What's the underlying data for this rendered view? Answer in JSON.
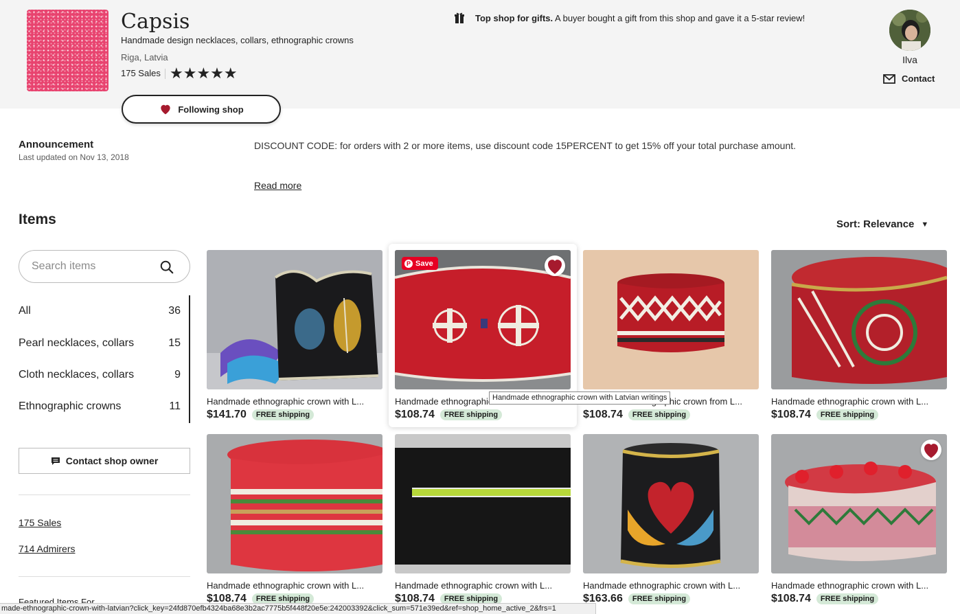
{
  "shop": {
    "name": "Capsis",
    "tagline": "Handmade design necklaces, collars, ethnographic crowns",
    "location": "Riga, Latvia",
    "sales": "175 Sales",
    "rating": 5,
    "stars_display": "★★★★★",
    "follow_label": "Following shop"
  },
  "gift_banner": {
    "bold": "Top shop for gifts.",
    "text": " A buyer bought a gift from this shop and gave it a 5-star review!"
  },
  "owner": {
    "name": "Ilva",
    "contact_label": "Contact"
  },
  "announcement": {
    "title": "Announcement",
    "updated": "Last updated on Nov 13, 2018",
    "text": "DISCOUNT CODE: for orders with 2 or more items, use discount code 15PERCENT to get 15% off your total purchase amount.",
    "read_more": "Read more"
  },
  "items": {
    "title": "Items",
    "sort_label": "Sort: Relevance",
    "search_placeholder": "Search items",
    "sections": [
      {
        "label": "All",
        "count": "36"
      },
      {
        "label": "Pearl necklaces, collars",
        "count": "15"
      },
      {
        "label": "Cloth necklaces, collars",
        "count": "9"
      },
      {
        "label": "Ethnographic crowns",
        "count": "11"
      }
    ],
    "contact_owner_label": "Contact shop owner",
    "sales_link": "175 Sales",
    "admirers_link": "714 Admirers"
  },
  "listings": [
    {
      "title": "Handmade ethnographic crown with L...",
      "price": "$141.70",
      "shipping": "FREE shipping"
    },
    {
      "title": "Handmade ethnographic crown with Latvian writings",
      "price": "$108.74",
      "shipping": "FREE shipping"
    },
    {
      "title": "Handmade ethnographic crown from L...",
      "price": "$108.74",
      "shipping": "FREE shipping"
    },
    {
      "title": "Handmade ethnographic crown with L...",
      "price": "$108.74",
      "shipping": "FREE shipping"
    },
    {
      "title": "Handmade ethnographic crown with L...",
      "price": "$108.74",
      "shipping": "FREE shipping"
    },
    {
      "title": "Handmade ethnographic crown with L...",
      "price": "$108.74",
      "shipping": "FREE shipping"
    },
    {
      "title": "Handmade ethnographic crown with L...",
      "price": "$163.66",
      "shipping": "FREE shipping"
    },
    {
      "title": "Handmade ethnographic crown with L...",
      "price": "$108.74",
      "shipping": "FREE shipping"
    }
  ],
  "hover_card": {
    "save_label": "Save",
    "tooltip": "Handmade ethnographic crown with Latvian writings"
  },
  "status_bar": "made-ethnographic-crown-with-latvian?click_key=24fd870efb4324ba68e3b2ac7775b5f448f20e5e:242003392&click_sum=571e39ed&ref=shop_home_active_2&frs=1",
  "partial_heading": "Featured Items For",
  "colors": {
    "heart_red": "#a61a2e",
    "ship_badge": "#d4e9d7",
    "logo_pink": "#e8436f",
    "pinterest_red": "#e60023"
  }
}
